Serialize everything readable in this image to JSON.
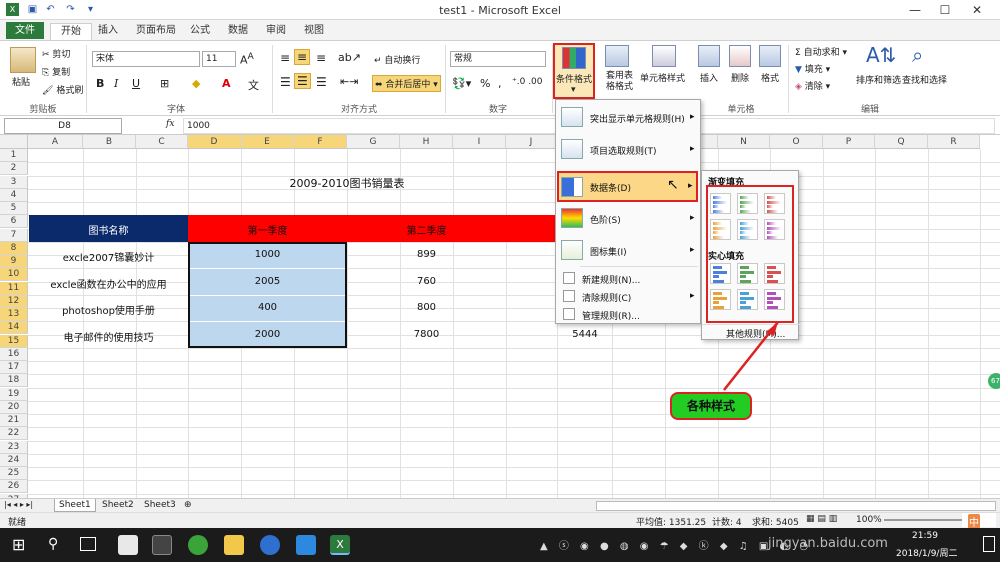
{
  "window": {
    "title": "test1 - Microsoft Excel",
    "minimize": "—",
    "maximize": "☐",
    "close": "✕"
  },
  "tabs": [
    "文件",
    "开始",
    "插入",
    "页面布局",
    "公式",
    "数据",
    "审阅",
    "视图"
  ],
  "ribbon": {
    "clipboard": {
      "paste": "粘贴",
      "cut": "剪切",
      "copy": "复制",
      "format_painter": "格式刷",
      "label": "剪贴板"
    },
    "font": {
      "name": "宋体",
      "size": "11",
      "label": "字体"
    },
    "alignment": {
      "wrap": "自动换行",
      "merge": "合并后居中",
      "label": "对齐方式"
    },
    "number": {
      "format": "常规",
      "label": "数字"
    },
    "styles": {
      "conditional": "条件格式",
      "table": "套用表格格式",
      "cell_styles": "单元格样式"
    },
    "cells": {
      "insert": "插入",
      "delete": "删除",
      "format": "格式",
      "label": "单元格"
    },
    "editing": {
      "autosum": "自动求和",
      "fill": "填充",
      "clear": "清除",
      "sort": "排序和筛选",
      "find": "查找和选择",
      "label": "编辑"
    }
  },
  "formula_bar": {
    "name_box": "D8",
    "fx": "fx",
    "value": "1000"
  },
  "columns": [
    "A",
    "B",
    "C",
    "D",
    "E",
    "F",
    "G",
    "H",
    "I",
    "J",
    "K",
    "L",
    "M",
    "N",
    "O",
    "P",
    "Q",
    "R"
  ],
  "rows": [
    "1",
    "2",
    "3",
    "4",
    "5",
    "6",
    "7",
    "8",
    "9",
    "10",
    "11",
    "12",
    "13",
    "14",
    "15",
    "16",
    "17",
    "18",
    "19",
    "20",
    "21",
    "22",
    "23",
    "24",
    "25",
    "26",
    "27"
  ],
  "sheet": {
    "title": "2009-2010图书销量表",
    "header_name": "图书名称",
    "header_q1": "第一季度",
    "header_q2": "第二季度",
    "data": [
      {
        "name": "excle2007锦囊妙计",
        "q1": "1000",
        "q2": "899",
        "q3": ""
      },
      {
        "name": "excle函数在办公中的应用",
        "q1": "2005",
        "q2": "760",
        "q3": ""
      },
      {
        "name": "photoshop使用手册",
        "q1": "400",
        "q2": "800",
        "q3": ""
      },
      {
        "name": "电子邮件的使用技巧",
        "q1": "2000",
        "q2": "7800",
        "q3": "5444"
      }
    ]
  },
  "cf_menu": {
    "items": [
      "突出显示单元格规则(H)",
      "项目选取规则(T)",
      "数据条(D)",
      "色阶(S)",
      "图标集(I)"
    ],
    "small_items": [
      "新建规则(N)...",
      "清除规则(C)",
      "管理规则(R)..."
    ]
  },
  "databar_menu": {
    "gradient": "渐变填充",
    "solid": "实心填充",
    "more": "其他规则(M)..."
  },
  "annotation": "各种样式",
  "sheet_tabs": [
    "Sheet1",
    "Sheet2",
    "Sheet3"
  ],
  "status": {
    "ready": "就绪",
    "average": "平均值: 1351.25",
    "count": "计数: 4",
    "sum": "求和: 5405",
    "zoom": "100%"
  },
  "taskbar": {
    "time": "21:59",
    "date": "2018/1/9/周二",
    "watermark": "jingyan.baidu.com",
    "ime": "中"
  },
  "colors": {
    "accent": "#2c7a3c",
    "header_blue": "#0b2a6b",
    "header_red": "#ff0000",
    "selection": "#bdd7ee",
    "highlight_border": "#d22222",
    "note_green": "#22cc22"
  }
}
